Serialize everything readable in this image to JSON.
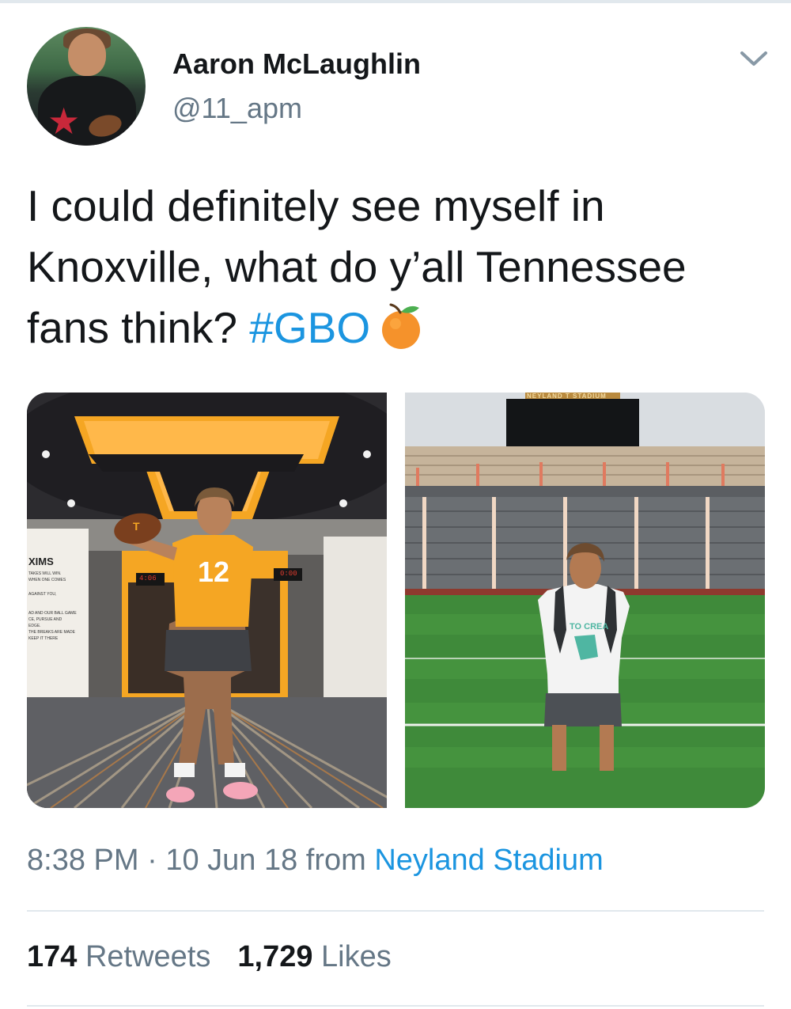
{
  "tweet": {
    "author": {
      "display_name": "Aaron McLaughlin",
      "handle": "@11_apm"
    },
    "text_before_hashtag": "I could definitely see myself in Knoxville, what do y’all Tennessee fans think? ",
    "hashtag": "#GBO",
    "emoji": "orange-emoji",
    "time": "8:38 PM",
    "separator": "·",
    "date": "10 Jun 18",
    "from_label": "from",
    "location": "Neyland Stadium",
    "retweets_count": "174",
    "retweets_label": "Retweets",
    "likes_count": "1,729",
    "likes_label": "Likes"
  },
  "media": {
    "left_photo": {
      "wall_sign_heading": "XIMS",
      "wall_sign_lines": [
        "TAKES WILL WIN.",
        "WHEN ONE COMES",
        "AGAINST YOU,",
        "AD AND OUR BALL GAME",
        "CE, PURSUE AND",
        "EDGE.",
        "THE BREAKS ARE MADE",
        "KEEP IT THERE"
      ],
      "clock_left": "4:06",
      "clock_right": "0:00",
      "jersey_number": "12",
      "ceiling_logo": "T"
    },
    "right_photo": {
      "scoreboard_text": "NEYLAND T STADIUM",
      "shirt_text": "TO CREA"
    }
  },
  "colors": {
    "link_blue": "#1b95e0",
    "text_dark": "#14171a",
    "text_gray": "#657786",
    "divider": "#e1e8ed",
    "tennessee_orange": "#f5962b"
  }
}
